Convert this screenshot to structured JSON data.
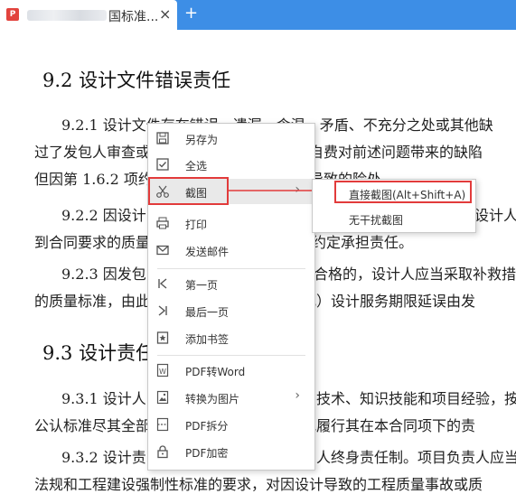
{
  "tab": {
    "title": "国标准...",
    "close": "×",
    "add": "+",
    "pdf_badge": "P"
  },
  "doc": {
    "lines": [
      "过了发包人审查或",
      "但因第 1.6.2 项约",
      "到合同要求的质量",
      "的质量标准，由此",
      "公认标准尽其全部",
      "法规和工程建设强制性标准的要求，对因设计导致的工程质量事故或质"
    ],
    "heading_92": "9.2  设计文件错误责任",
    "p921_a": "9.2.1  设计文件存在错误、遗漏、含混、矛盾、不充分之处或其他缺",
    "p921_b_right": "均应自费对前述问题带来的缺陷",
    "p921_c_right": "错误导致的险处",
    "p922_a": "9.2.2  因设计",
    "p922_a_right": "设计人",
    "p922_b_right": "约定承担责任。",
    "p923_a": "9.2.3  因发包",
    "p923_a_right": "合格的，设计人应当采取补救措",
    "p923_b_right": "（或）设计服务期限延误由发",
    "heading_93": "9.3  设计责任",
    "p931_a": "9.3.1  设计人",
    "p931_a_right": "技术、知识技能和项目经验，按",
    "p931_b_right": "正地履行其在本合同项下的责",
    "p932_a": "9.3.2  设计责",
    "p932_a_right": "人终身责任制。项目负责人应当"
  },
  "menu": {
    "items": [
      {
        "label": "另存为",
        "icon": "save-icon"
      },
      {
        "label": "全选",
        "icon": "select-all-icon"
      },
      {
        "label": "截图",
        "icon": "scissors-icon",
        "has_submenu": true
      },
      {
        "label": "打印",
        "icon": "printer-icon"
      },
      {
        "label": "发送邮件",
        "icon": "mail-icon"
      },
      {
        "label": "第一页",
        "icon": "first-page-icon"
      },
      {
        "label": "最后一页",
        "icon": "last-page-icon"
      },
      {
        "label": "添加书签",
        "icon": "bookmark-icon"
      },
      {
        "label": "PDF转Word",
        "icon": "word-icon"
      },
      {
        "label": "转换为图片",
        "icon": "image-icon",
        "has_submenu": true
      },
      {
        "label": "PDF拆分",
        "icon": "split-icon"
      },
      {
        "label": "PDF加密",
        "icon": "lock-icon"
      }
    ],
    "arrow": "›"
  },
  "submenu": {
    "items": [
      {
        "label": "直接截图(Alt+Shift+A)"
      },
      {
        "label": "无干扰截图"
      }
    ]
  },
  "colors": {
    "tabbar": "#3d8ee6",
    "highlight": "#e23b3b"
  }
}
